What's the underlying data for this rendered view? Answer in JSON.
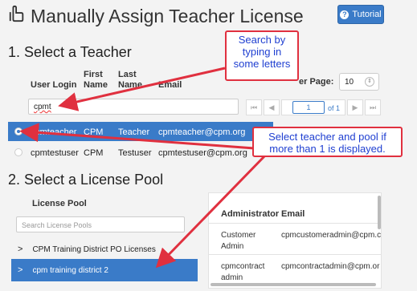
{
  "header": {
    "title": "Manually Assign Teacher License",
    "tutorial_label": "Tutorial"
  },
  "section1": {
    "heading": "1. Select a Teacher",
    "columns": {
      "login": "User Login",
      "first": [
        "First",
        "Name"
      ],
      "last": [
        "Last",
        "Name"
      ],
      "email": "Email"
    },
    "search_value": "cpmt",
    "per_page_label": "er Page:",
    "per_page_value": "10",
    "pager": {
      "page": "1",
      "of": "of 1"
    },
    "rows": [
      {
        "login": "cpmteacher",
        "first": "CPM",
        "last": "Teacher",
        "email": "cpmteacher@cpm.org",
        "selected": true
      },
      {
        "login": "cpmtestuser",
        "first": "CPM",
        "last": "Testuser",
        "email": "cpmtestuser@cpm.org",
        "selected": false
      }
    ]
  },
  "section2": {
    "heading": "2. Select a License Pool",
    "pool_header": "License Pool",
    "pool_search_placeholder": "Search License Pools",
    "pools": [
      {
        "name": "CPM Training District PO Licenses",
        "selected": false
      },
      {
        "name": "cpm training district 2",
        "selected": true
      }
    ],
    "admin_columns": {
      "admin": "Administrator",
      "email": "Email"
    },
    "admins": [
      {
        "admin": [
          "Customer",
          "Admin"
        ],
        "email": "cpmcustomeradmin@cpm.c"
      },
      {
        "admin": [
          "cpmcontract",
          "admin"
        ],
        "email": "cpmcontractadmin@cpm.or"
      }
    ]
  },
  "annotations": {
    "callout1": [
      "Search by",
      "typing in",
      "some letters"
    ],
    "callout2": [
      "Select teacher and pool if",
      "more than 1 is displayed."
    ]
  },
  "colors": {
    "accent": "#3a7bc8",
    "callout_border": "#e0303f",
    "callout_text": "#1f3fd1"
  },
  "icons": [
    "hand-pointer-icon",
    "question-circle-icon",
    "chevron-right-icon",
    "first-page-icon",
    "prev-page-icon",
    "next-page-icon",
    "last-page-icon"
  ]
}
